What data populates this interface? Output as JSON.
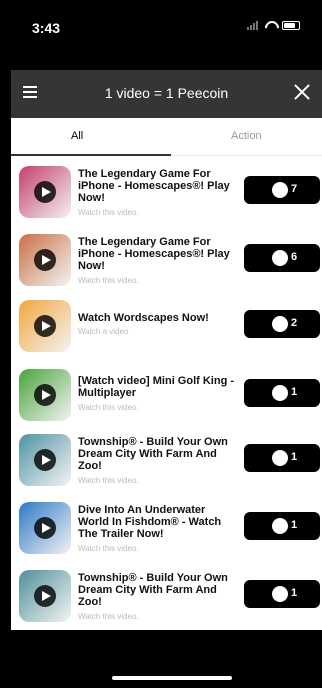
{
  "status": {
    "time": "3:43"
  },
  "nav": {
    "title": "1 video = 1 Peecoin"
  },
  "tabs": [
    {
      "label": "All"
    },
    {
      "label": "Action"
    }
  ],
  "items": [
    {
      "title": "The Legendary Game For iPhone - Homescapes®! Play Now!",
      "subtitle": "Watch this video.",
      "reward": "7",
      "color": "#c43f6a"
    },
    {
      "title": "The Legendary Game For iPhone - Homescapes®! Play Now!",
      "subtitle": "Watch this video.",
      "reward": "6",
      "color": "#c96f45"
    },
    {
      "title": "Watch Wordscapes Now!",
      "subtitle": "Watch a video",
      "reward": "2",
      "color": "#f2a73d"
    },
    {
      "title": "[Watch video] Mini Golf King - Multiplayer",
      "subtitle": "Watch this video.",
      "reward": "1",
      "color": "#4aa33a"
    },
    {
      "title": "Township® - Build Your Own Dream City With Farm And Zoo!",
      "subtitle": "Watch this video.",
      "reward": "1",
      "color": "#4f93a5"
    },
    {
      "title": "Dive Into An Underwater World In Fishdom® - Watch The Trailer Now!",
      "subtitle": "Watch this video.",
      "reward": "1",
      "color": "#2e78c7"
    },
    {
      "title": "Township® - Build Your Own Dream City With Farm And Zoo!",
      "subtitle": "Watch this video.",
      "reward": "1",
      "color": "#508f9b"
    }
  ]
}
